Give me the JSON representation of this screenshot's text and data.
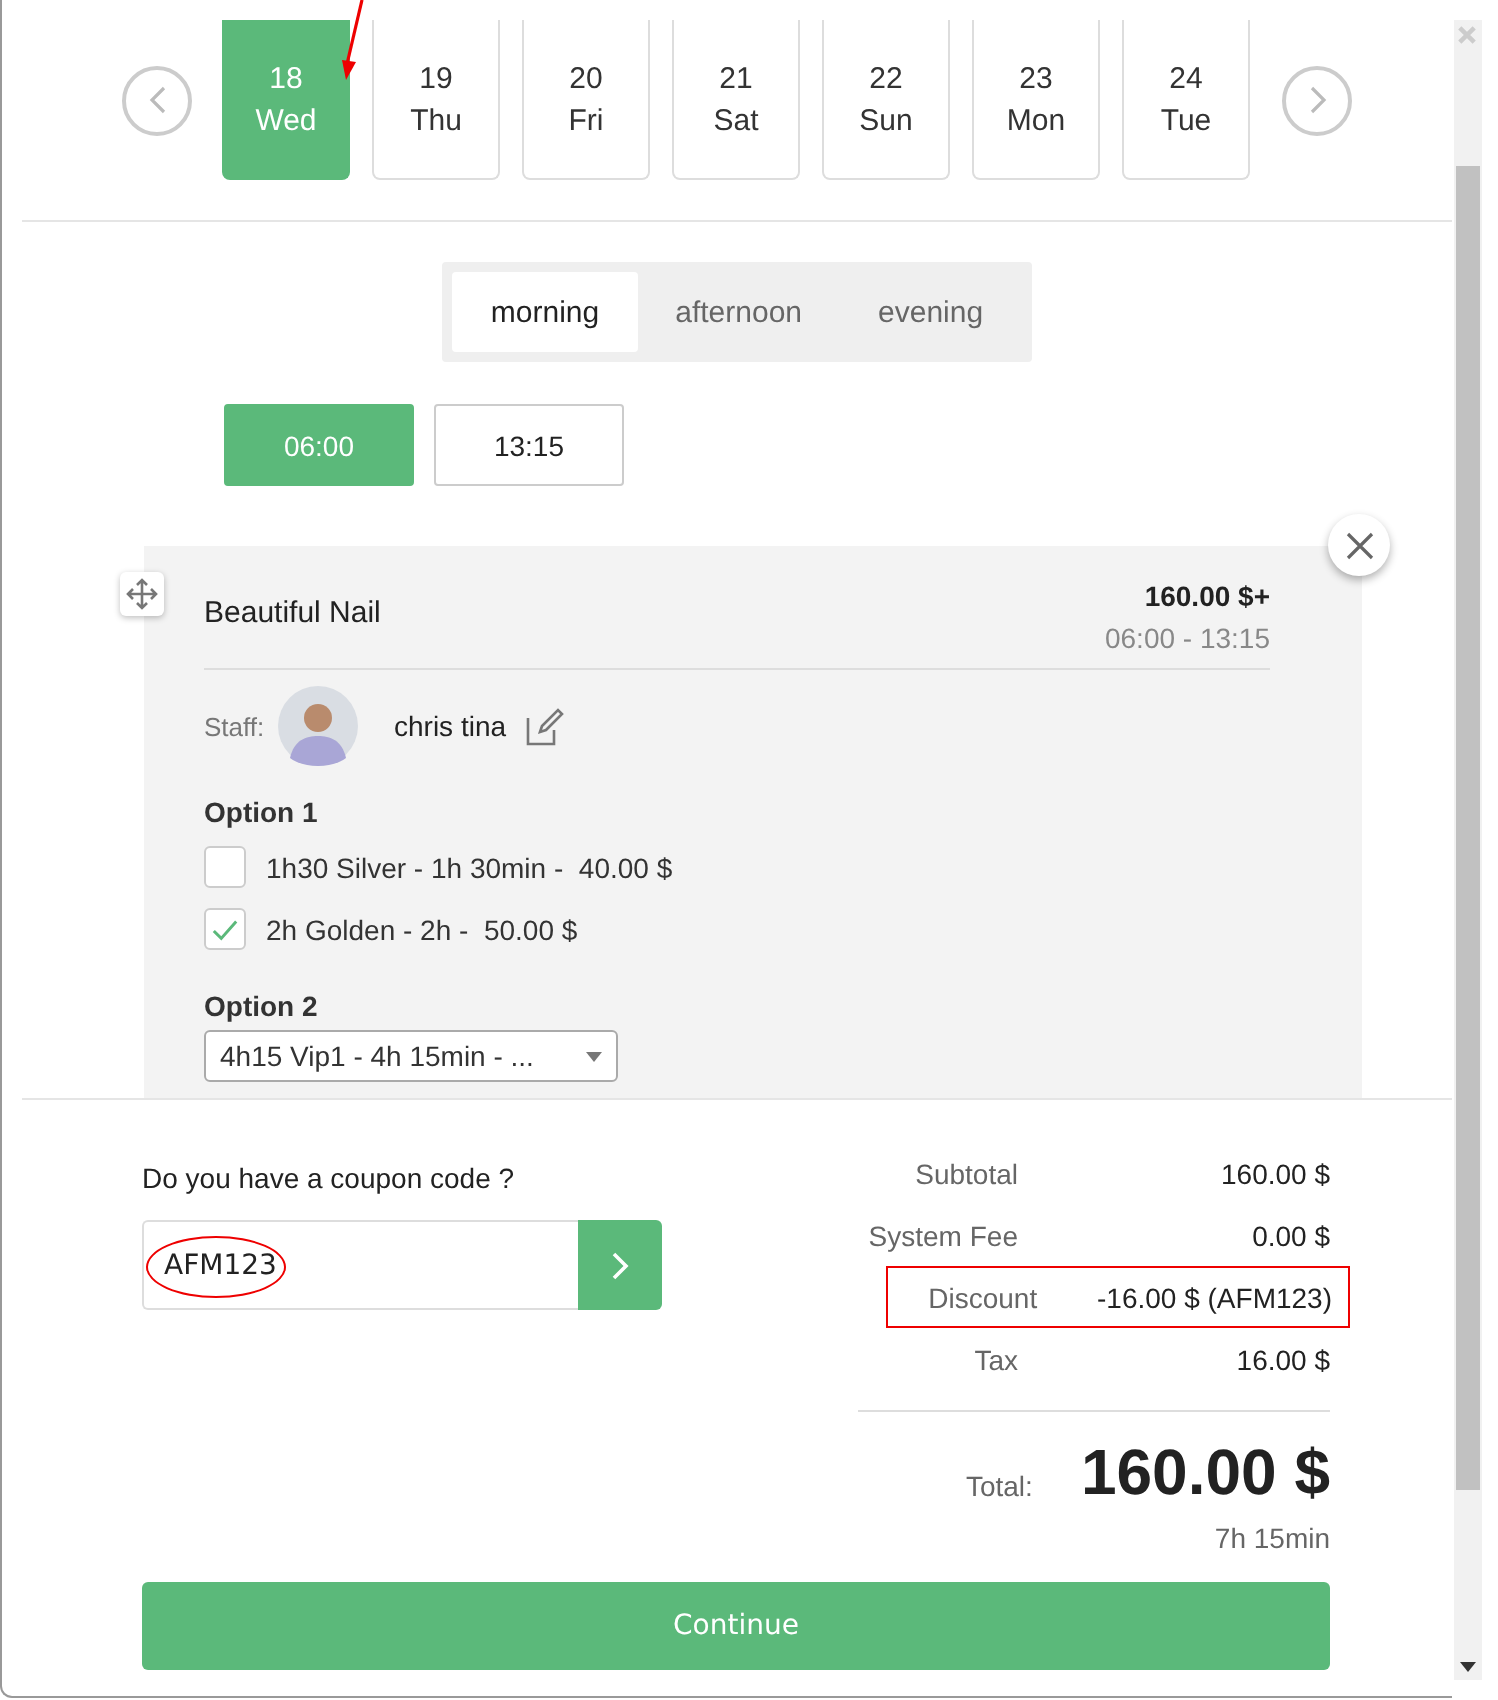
{
  "days": [
    {
      "day": "18",
      "weekday": "Wed",
      "selected": true,
      "marked": true
    },
    {
      "day": "19",
      "weekday": "Thu",
      "selected": false,
      "marked": false
    },
    {
      "day": "20",
      "weekday": "Fri",
      "selected": false,
      "marked": false
    },
    {
      "day": "21",
      "weekday": "Sat",
      "selected": false,
      "marked": false
    },
    {
      "day": "22",
      "weekday": "Sun",
      "selected": false,
      "marked": false
    },
    {
      "day": "23",
      "weekday": "Mon",
      "selected": false,
      "marked": false
    },
    {
      "day": "24",
      "weekday": "Tue",
      "selected": false,
      "marked": false
    }
  ],
  "periods": [
    {
      "label": "morning",
      "selected": true
    },
    {
      "label": "afternoon",
      "selected": false
    },
    {
      "label": "evening",
      "selected": false
    }
  ],
  "time_slots": [
    {
      "label": "06:00",
      "selected": true
    },
    {
      "label": "13:15",
      "selected": false
    }
  ],
  "service": {
    "name": "Beautiful Nail",
    "price": "160.00 $+",
    "time_range": "06:00 - 13:15",
    "staff_label": "Staff:",
    "staff_name": "chris tina",
    "options": [
      {
        "kind": "checkbox",
        "title": "Option 1",
        "items": [
          {
            "label": "1h30 Silver - 1h 30min -  40.00 $",
            "checked": false
          },
          {
            "label": "2h Golden - 2h -  50.00 $",
            "checked": true
          }
        ]
      },
      {
        "kind": "select",
        "title": "Option 2",
        "value": "4h15 Vip1 - 4h 15min - ..."
      }
    ]
  },
  "coupon": {
    "label": "Do you have a coupon code ?",
    "value": "AFM123",
    "highlighted": true
  },
  "summary": [
    {
      "label": "Subtotal",
      "value": "160.00 $",
      "highlighted": false
    },
    {
      "label": "System Fee",
      "value": "0.00 $",
      "highlighted": false
    },
    {
      "label": "Discount",
      "value": "-16.00 $ (AFM123)",
      "highlighted": true
    },
    {
      "label": "Tax",
      "value": "16.00 $",
      "highlighted": false
    }
  ],
  "total": {
    "label": "Total:",
    "value": "160.00 $",
    "duration": "7h 15min"
  },
  "continue_button": "Continue"
}
